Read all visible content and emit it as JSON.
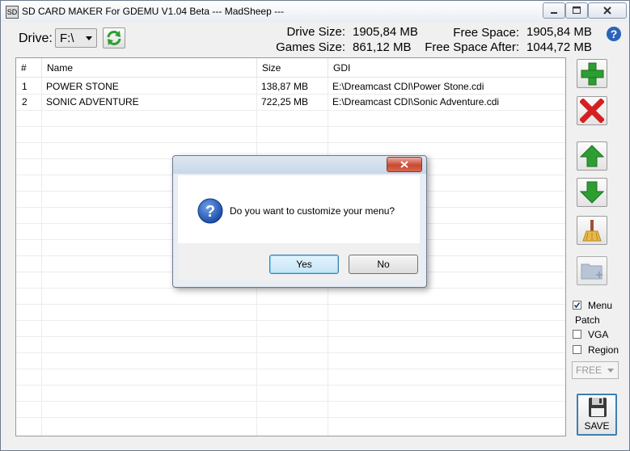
{
  "window": {
    "title": "SD CARD MAKER For GDEMU  V1.04 Beta ---  MadSheep ---",
    "app_icon_text": "SD"
  },
  "toolbar": {
    "drive_label": "Drive:",
    "drive_value": "F:\\",
    "refresh_icon": "refresh-icon"
  },
  "info": {
    "drive_size_label": "Drive Size:",
    "drive_size_value": "1905,84 MB",
    "games_size_label": "Games Size:",
    "games_size_value": "861,12 MB",
    "free_space_label": "Free Space:",
    "free_space_value": "1905,84 MB",
    "free_space_after_label": "Free Space After:",
    "free_space_after_value": "1044,72 MB"
  },
  "table": {
    "columns": [
      "#",
      "Name",
      "Size",
      "GDI"
    ],
    "rows": [
      {
        "num": "1",
        "name": "POWER STONE",
        "size": "138,87 MB",
        "gdi": "E:\\Dreamcast CDI\\Power Stone.cdi"
      },
      {
        "num": "2",
        "name": "SONIC ADVENTURE",
        "size": "722,25 MB",
        "gdi": "E:\\Dreamcast CDI\\Sonic Adventure.cdi"
      }
    ]
  },
  "side": {
    "menu_label": "Menu",
    "menu_checked": true,
    "patch_label": "Patch",
    "vga_label": "VGA",
    "region_label": "Region",
    "free_value": "FREE",
    "save_label": "SAVE"
  },
  "dialog": {
    "message": "Do you want to customize your menu?",
    "yes_label": "Yes",
    "no_label": "No"
  },
  "colors": {
    "green": "#2e9e32",
    "red": "#d42020",
    "accent": "#3c7fb1"
  }
}
